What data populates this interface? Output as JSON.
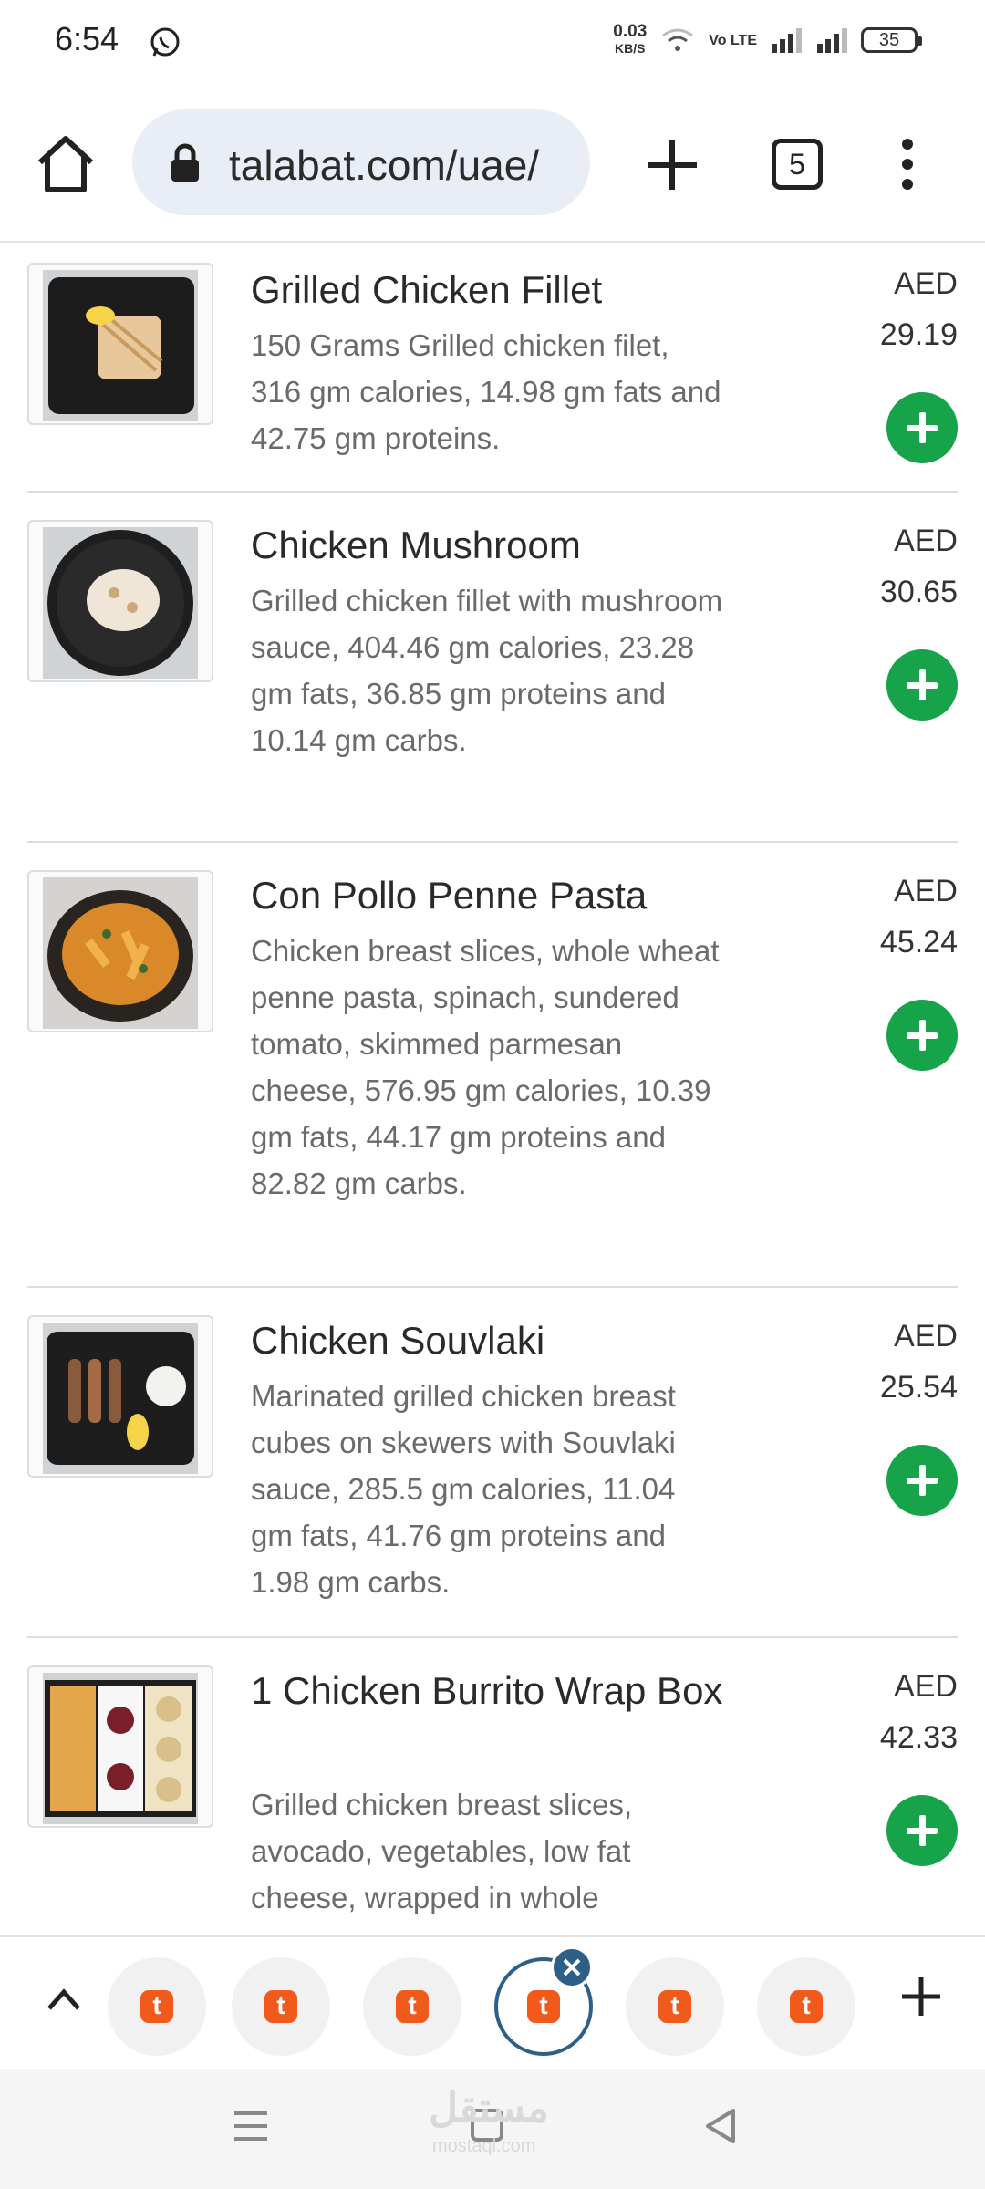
{
  "status_bar": {
    "time": "6:54",
    "net_speed": "0.03",
    "net_unit": "KB/S",
    "volte": "Vo LTE",
    "battery": "35"
  },
  "browser": {
    "url": "talabat.com/uae/",
    "tab_count": "5"
  },
  "menu_items": [
    {
      "name": "Grilled Chicken Fillet",
      "desc": "150 Grams Grilled chicken filet, 316 gm calories, 14.98 gm fats and 42.75 gm proteins.",
      "currency": "AED",
      "price": "29.19"
    },
    {
      "name": "Chicken Mushroom",
      "desc": "Grilled chicken fillet with mushroom sauce, 404.46 gm calories, 23.28 gm fats, 36.85 gm proteins and 10.14 gm carbs.",
      "currency": "AED",
      "price": "30.65"
    },
    {
      "name": "Con Pollo Penne Pasta",
      "desc": "Chicken breast slices, whole wheat penne pasta, spinach, sundered tomato, skimmed parmesan cheese, 576.95 gm calories, 10.39 gm fats, 44.17 gm proteins and 82.82 gm carbs.",
      "currency": "AED",
      "price": "45.24"
    },
    {
      "name": "Chicken Souvlaki",
      "desc": "Marinated grilled chicken breast cubes on skewers with Souvlaki sauce, 285.5 gm calories, 11.04 gm fats, 41.76 gm proteins and 1.98 gm carbs.",
      "currency": "AED",
      "price": "25.54"
    },
    {
      "name": "1 Chicken Burrito Wrap Box",
      "desc": "Grilled chicken breast slices, avocado, vegetables, low fat cheese, wrapped in whole",
      "currency": "AED",
      "price": "42.33"
    }
  ],
  "tab_strip": {
    "logo_letter": "t"
  },
  "watermark": {
    "text": "مستقل",
    "sub": "mostaql.com"
  },
  "colors": {
    "add_button": "#17a34a",
    "talabat_orange": "#f25a1b",
    "active_tab_ring": "#2d5f87"
  },
  "icons": [
    "whatsapp-icon",
    "wifi-icon",
    "signal-icon",
    "battery-icon",
    "home-icon",
    "lock-icon",
    "plus-icon",
    "tabs-icon",
    "more-vert-icon",
    "chevron-up-icon",
    "close-icon",
    "nav-menu-icon",
    "nav-home-icon",
    "nav-back-icon"
  ]
}
